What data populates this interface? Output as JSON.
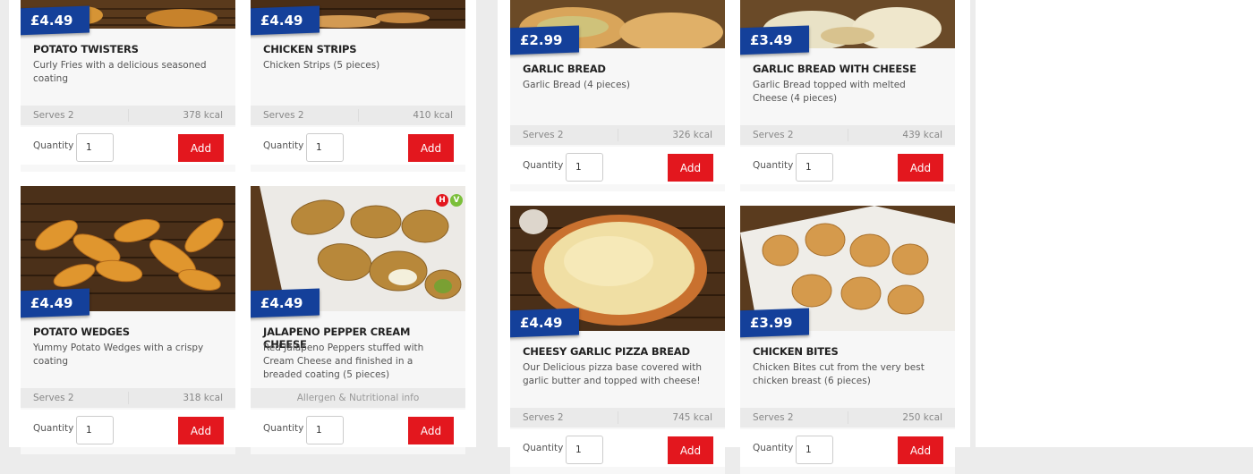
{
  "cards": [
    {
      "price": "£4.49",
      "name": "POTATO TWISTERS",
      "desc": "Curly Fries with a delicious seasoned coating",
      "serves": "Serves 2",
      "kcal": "378 kcal",
      "qty_label": "Quantity",
      "qty_value": "1",
      "add": "Add"
    },
    {
      "price": "£4.49",
      "name": "CHICKEN STRIPS",
      "desc": "Chicken Strips (5 pieces)",
      "serves": "Serves 2",
      "kcal": "410 kcal",
      "qty_label": "Quantity",
      "qty_value": "1",
      "add": "Add"
    },
    {
      "price": "£2.99",
      "name": "GARLIC BREAD",
      "desc": "Garlic Bread (4 pieces)",
      "serves": "Serves 2",
      "kcal": "326 kcal",
      "qty_label": "Quantity",
      "qty_value": "1",
      "add": "Add"
    },
    {
      "price": "£3.49",
      "name": "GARLIC BREAD WITH CHEESE",
      "desc": "Garlic Bread topped with melted Cheese (4 pieces)",
      "serves": "Serves 2",
      "kcal": "439 kcal",
      "qty_label": "Quantity",
      "qty_value": "1",
      "add": "Add"
    },
    {
      "price": "£4.49",
      "name": "POTATO WEDGES",
      "desc": "Yummy Potato Wedges with a crispy coating",
      "serves": "Serves 2",
      "kcal": "318 kcal",
      "qty_label": "Quantity",
      "qty_value": "1",
      "add": "Add"
    },
    {
      "price": "£4.49",
      "name": "JALAPENO PEPPER CREAM CHEESE",
      "desc": "Red Jalapeno Peppers stuffed with Cream Cheese and finished in a breaded coating (5 pieces)",
      "allergen": "Allergen & Nutritional info",
      "qty_label": "Quantity",
      "qty_value": "1",
      "add": "Add",
      "badges": [
        "H",
        "V"
      ]
    },
    {
      "price": "£4.49",
      "name": "CHEESY GARLIC PIZZA BREAD",
      "desc": "Our Delicious pizza base covered with garlic butter and topped with cheese!",
      "serves": "Serves 2",
      "kcal": "745 kcal",
      "qty_label": "Quantity",
      "qty_value": "1",
      "add": "Add"
    },
    {
      "price": "£3.99",
      "name": "CHICKEN BITES",
      "desc": "Chicken Bites cut from the very best chicken breast (6 pieces)",
      "serves": "Serves 2",
      "kcal": "250 kcal",
      "qty_label": "Quantity",
      "qty_value": "1",
      "add": "Add"
    }
  ],
  "colors": {
    "price_tag": "#14409a",
    "add_button": "#e3171e",
    "halal_badge": "#e3171e",
    "veg_badge": "#7bbf3a"
  }
}
